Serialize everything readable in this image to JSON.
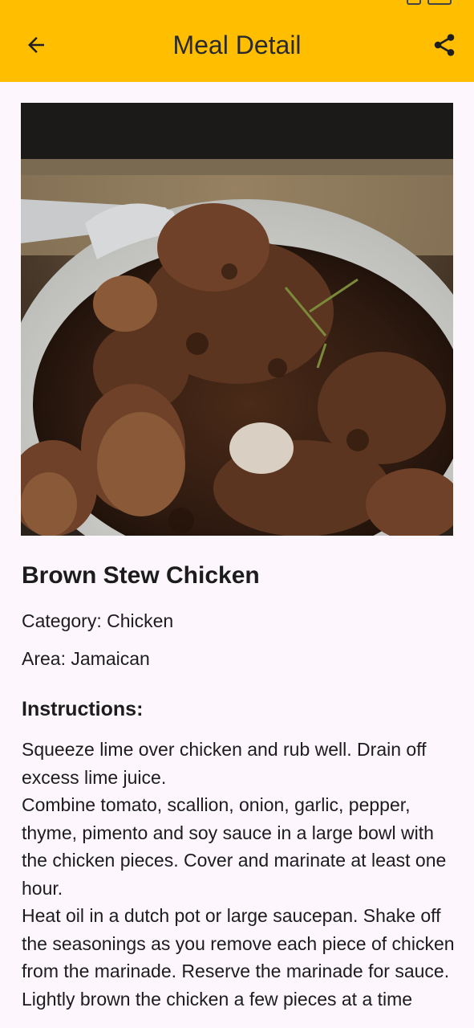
{
  "app_bar": {
    "title": "Meal Detail",
    "background_color": "#FFBF00",
    "back_icon": "arrow-left-icon",
    "share_icon": "share-icon"
  },
  "meal": {
    "name": "Brown Stew Chicken",
    "category_text": "Category: Chicken",
    "area_text": "Area: Jamaican",
    "image_description_icon": "meal-photo"
  },
  "instructions": {
    "heading": "Instructions:",
    "body": "Squeeze lime over chicken and rub well. Drain off excess lime juice.\nCombine tomato, scallion, onion, garlic, pepper, thyme, pimento and soy sauce in a large bowl with the chicken pieces. Cover and marinate at least one hour.\nHeat oil in a dutch pot or large saucepan. Shake off the seasonings as you remove each piece of chicken from the marinade. Reserve the marinade for sauce.\nLightly brown the chicken a few pieces at a time"
  }
}
